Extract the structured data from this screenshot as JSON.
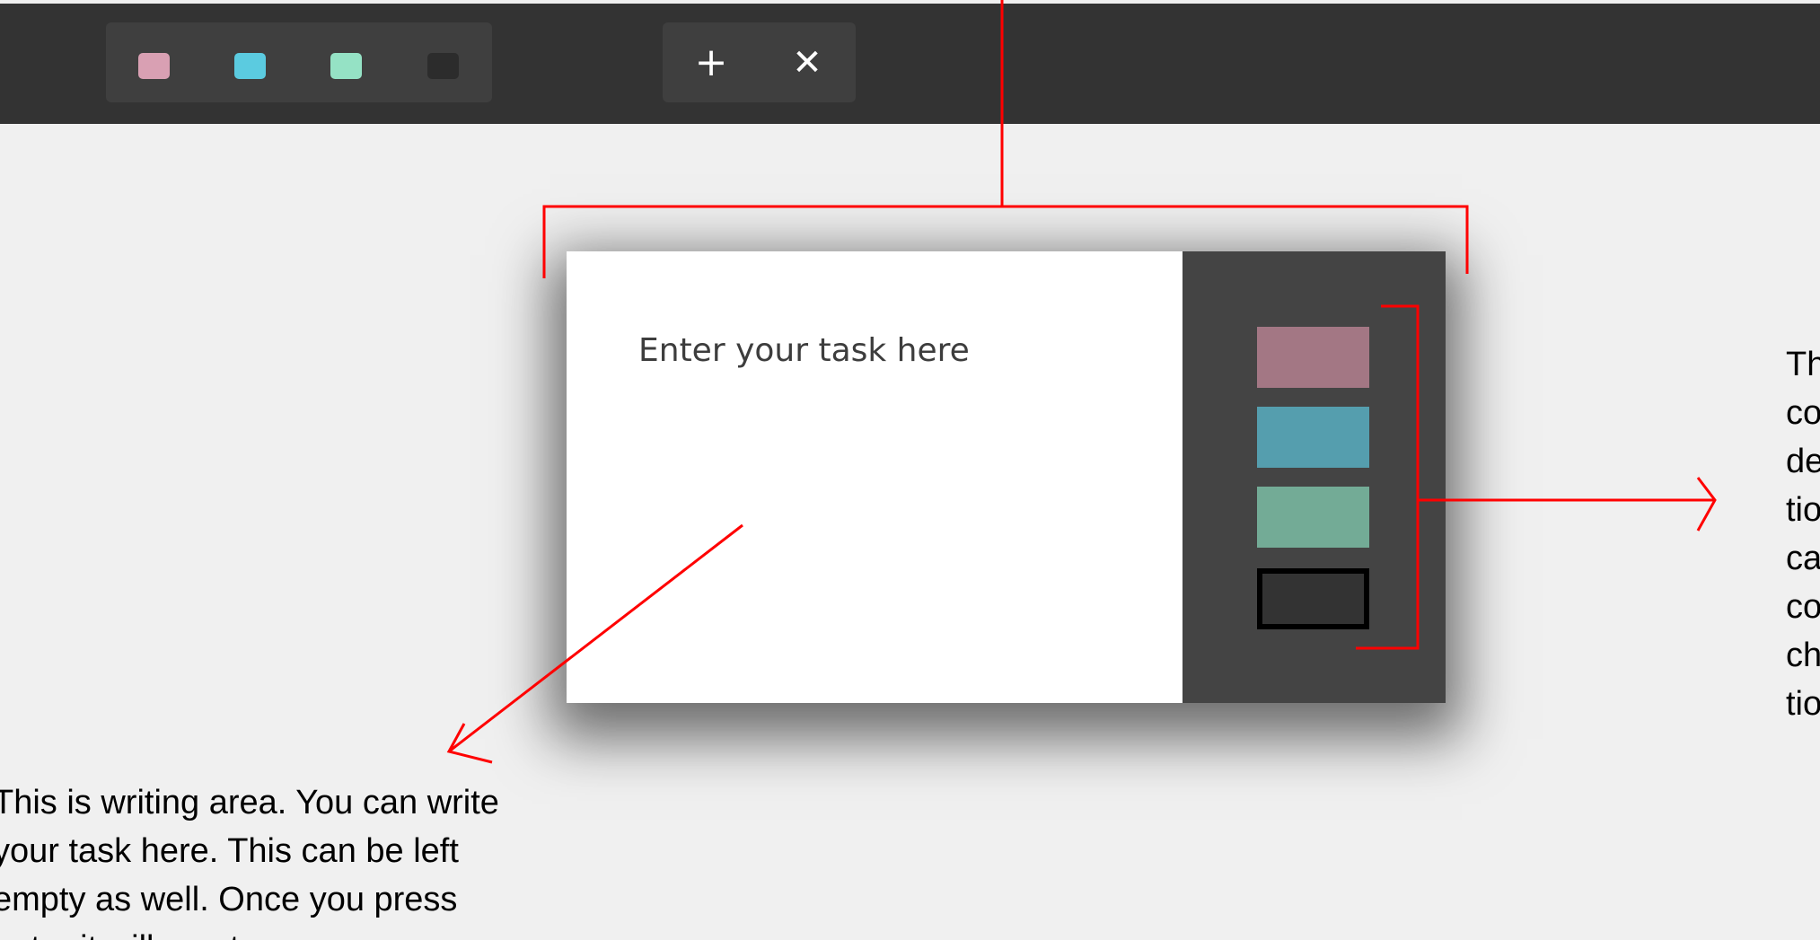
{
  "toolbar": {
    "color_swatches": [
      {
        "name": "pink-swatch",
        "color": "#d9a0b3"
      },
      {
        "name": "blue-swatch",
        "color": "#5bcbe0"
      },
      {
        "name": "green-swatch",
        "color": "#95e2c5"
      },
      {
        "name": "black-swatch",
        "color": "#2c2c2c"
      }
    ],
    "add_label": "+",
    "close_label": "✕"
  },
  "modal": {
    "placeholder": "Enter your task here",
    "color_options": [
      {
        "name": "pink-option",
        "color": "#a37784"
      },
      {
        "name": "blue-option",
        "color": "#559eae"
      },
      {
        "name": "green-option",
        "color": "#73ab96"
      },
      {
        "name": "black-option",
        "color": "#333333"
      }
    ]
  },
  "annotations": {
    "writing_area": "This is writing area. You can write your task here. This can be left empty as well. Once you press enter it will create",
    "color_panel": "Th\nco\nde\ntio\nca\nco\nch\ntio"
  },
  "annotation_color": "#ff0000"
}
